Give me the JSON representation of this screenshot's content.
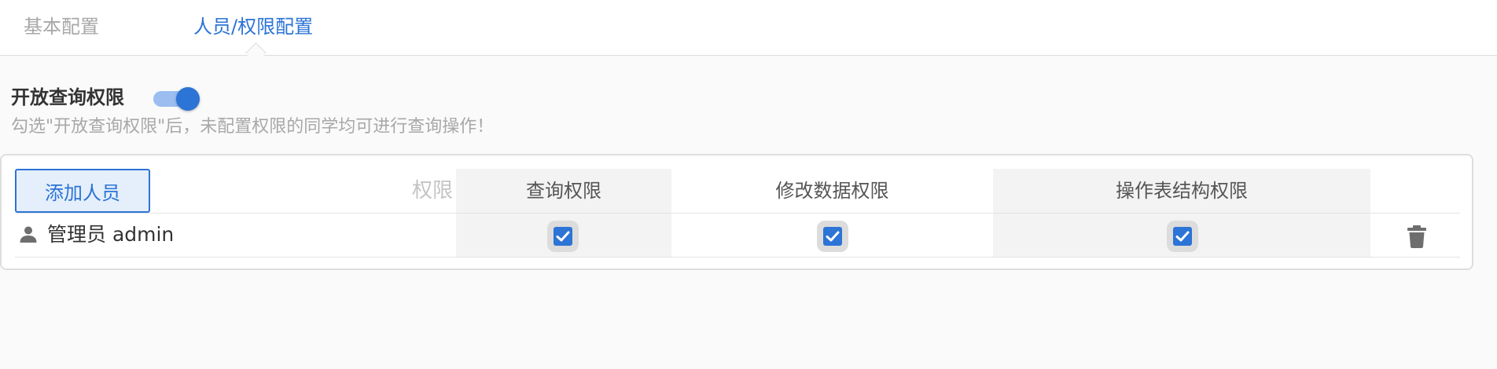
{
  "tabs": {
    "basic": "基本配置",
    "permissions": "人员/权限配置",
    "active": "permissions"
  },
  "query_permission": {
    "title": "开放查询权限",
    "enabled": true,
    "hint": "勾选\"开放查询权限\"后，未配置权限的同学均可进行查询操作！"
  },
  "table": {
    "add_button": "添加人员",
    "permission_label": "权限",
    "columns": [
      "查询权限",
      "修改数据权限",
      "操作表结构权限"
    ],
    "rows": [
      {
        "name": "管理员 admin",
        "icon": "user-icon",
        "permissions": [
          true,
          true,
          true
        ]
      }
    ]
  },
  "colors": {
    "accent": "#2c74d6",
    "accent_light": "#e4effb",
    "toggle_track": "#9bbdf0",
    "muted_text": "#a8a8a8"
  }
}
